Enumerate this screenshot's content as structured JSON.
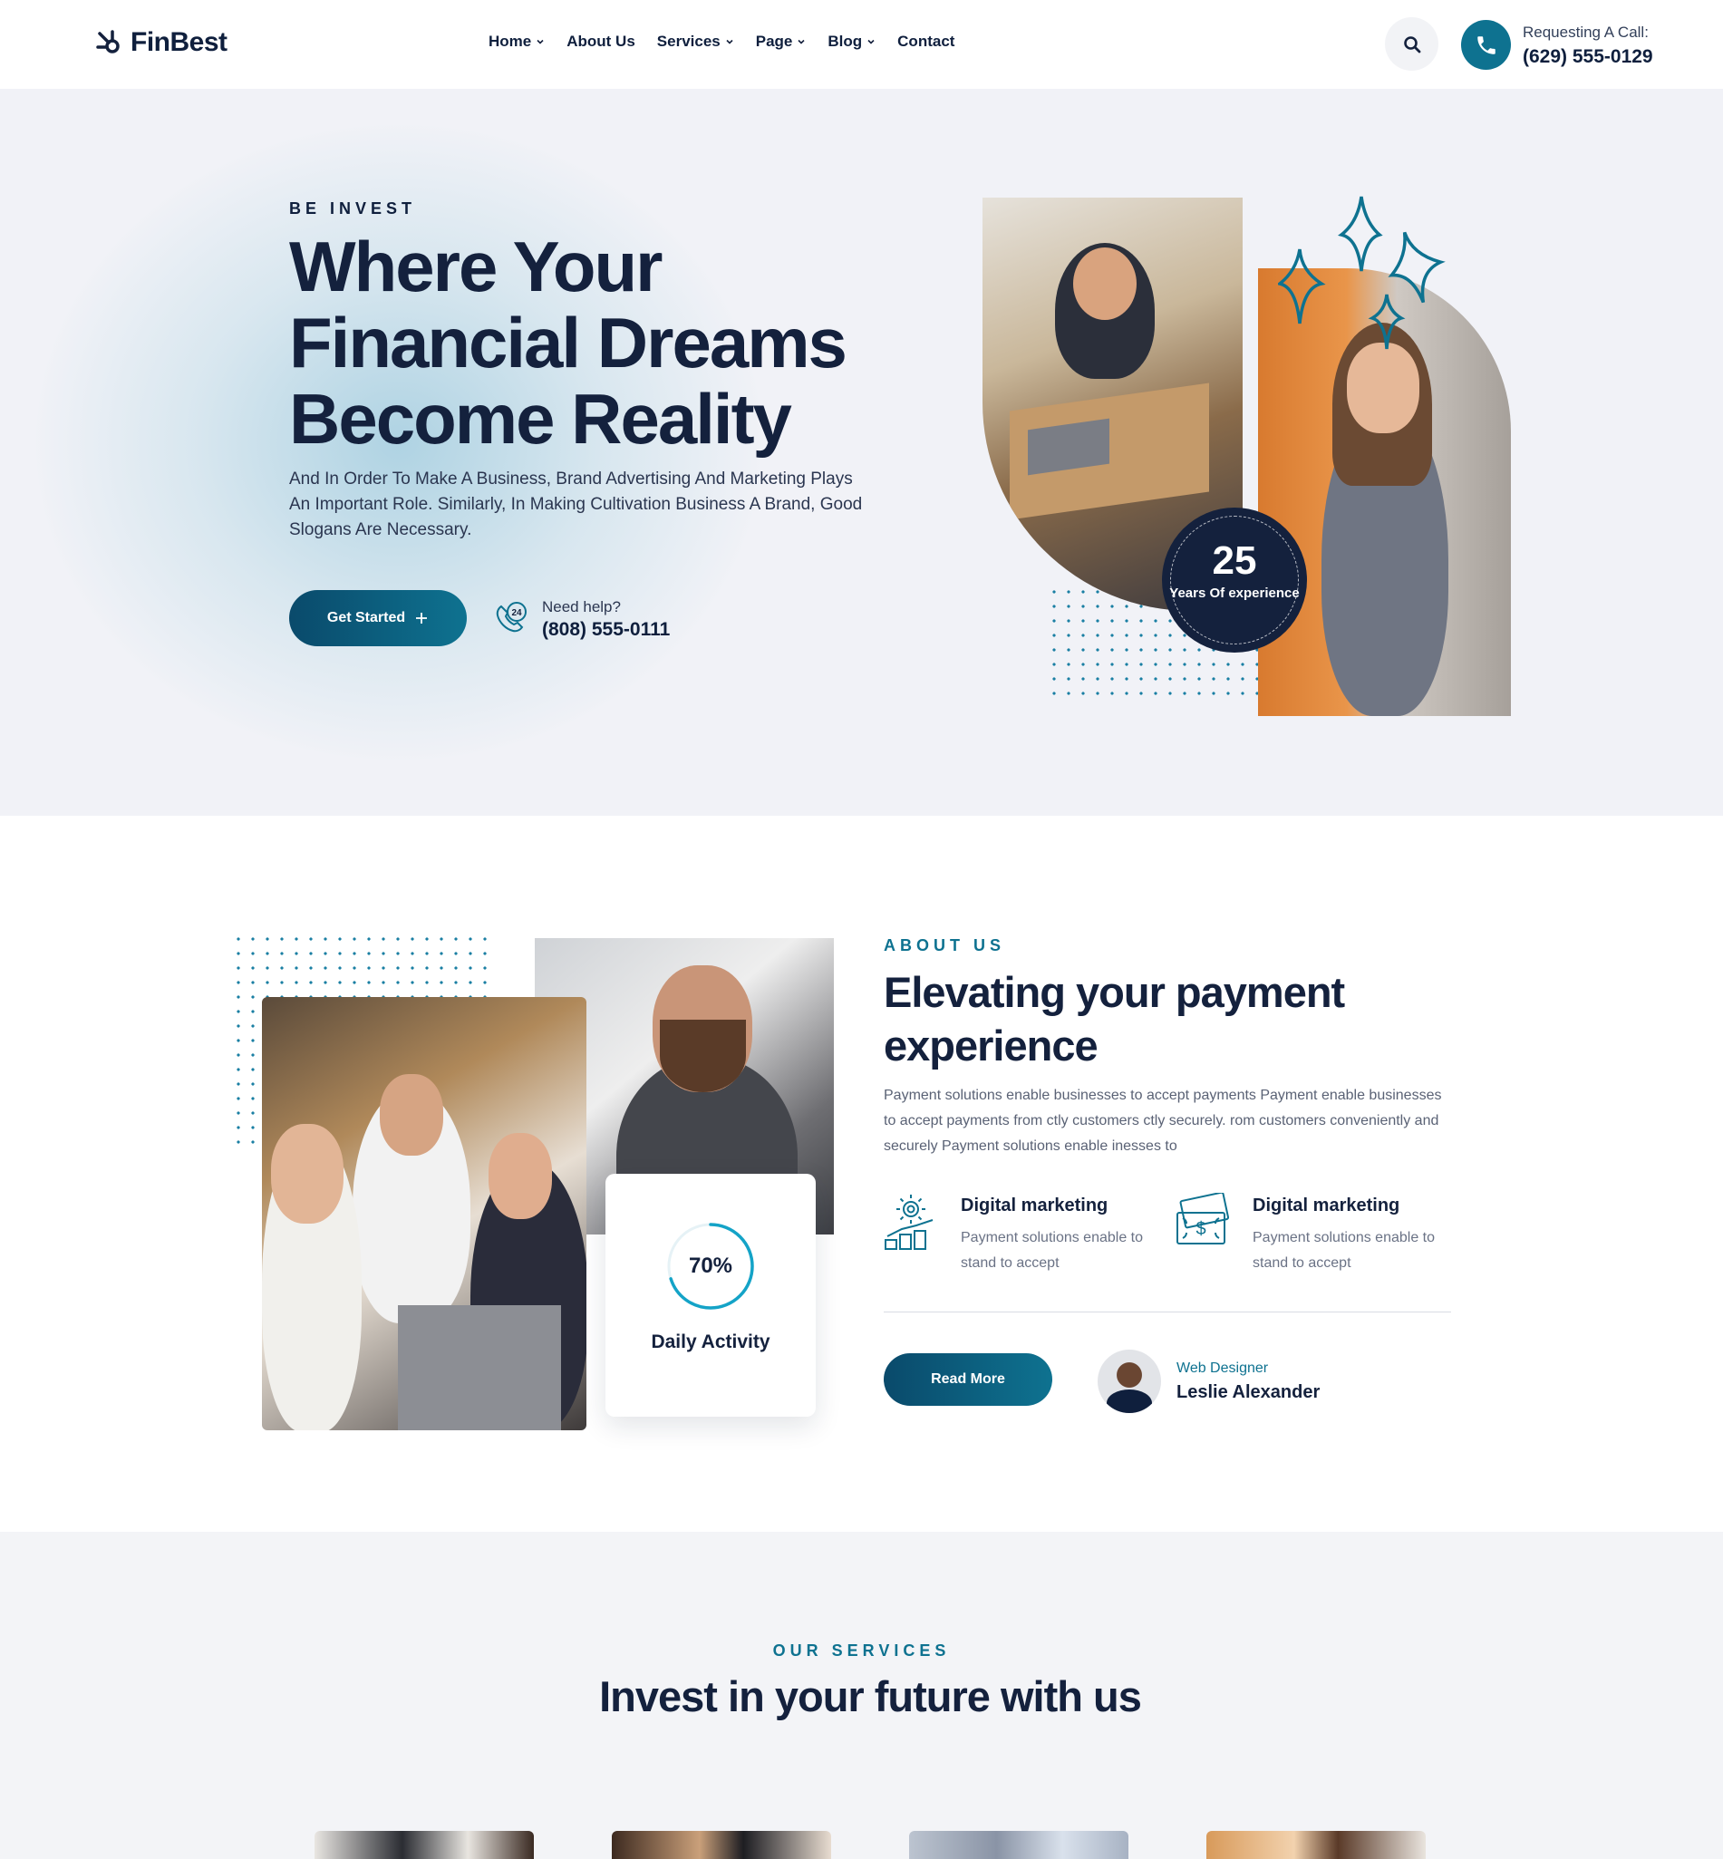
{
  "header": {
    "logo_text": "FinBest",
    "nav": [
      {
        "label": "Home",
        "dropdown": true
      },
      {
        "label": "About Us",
        "dropdown": false
      },
      {
        "label": "Services",
        "dropdown": true
      },
      {
        "label": "Page",
        "dropdown": true
      },
      {
        "label": "Blog",
        "dropdown": true
      },
      {
        "label": "Contact",
        "dropdown": false
      }
    ],
    "search_icon": "search-icon",
    "call_label": "Requesting A Call:",
    "call_number": "(629) 555-0129"
  },
  "hero": {
    "kicker": "BE INVEST",
    "title": "Where Your Financial Dreams Become Reality",
    "description": "And In Order To Make A Business, Brand Advertising And Marketing Plays An Important Role. Similarly, In Making Cultivation Business A Brand, Good Slogans Are Necessary.",
    "cta_label": "Get Started",
    "help_label": "Need help?",
    "help_number": "(808) 555-0111",
    "badge_number": "25",
    "badge_text": "Years Of experience"
  },
  "about": {
    "kicker": "ABOUT US",
    "title": "Elevating your payment experience",
    "description": "Payment solutions enable businesses to accept payments Payment enable businesses to accept payments from ctly customers ctly securely. rom customers conveniently and securely Payment solutions enable inesses to",
    "activity_value": "70%",
    "activity_percent": 70,
    "activity_label": "Daily Activity",
    "features": [
      {
        "title": "Digital marketing",
        "description": "Payment solutions enable to stand to accept",
        "icon": "gear-chart-icon"
      },
      {
        "title": "Digital marketing",
        "description": "Payment solutions enable to stand to accept",
        "icon": "money-icon"
      }
    ],
    "read_more_label": "Read More",
    "author_role": "Web Designer",
    "author_name": "Leslie Alexander"
  },
  "services": {
    "kicker": "OUR SERVICES",
    "title": "Invest in your future with us"
  },
  "colors": {
    "brand_dark": "#14213d",
    "accent": "#0e7290",
    "hero_bg": "#f1f2f7",
    "badge_orange": "#e9954a"
  }
}
